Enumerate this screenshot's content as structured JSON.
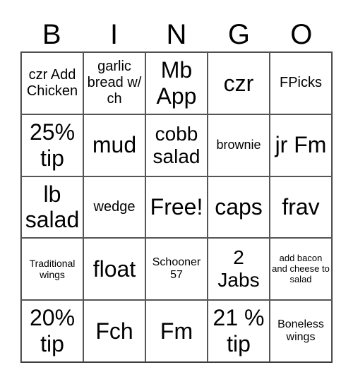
{
  "header": [
    "B",
    "I",
    "N",
    "G",
    "O"
  ],
  "cells": [
    {
      "text": "czr Add Chicken",
      "size": "s-m"
    },
    {
      "text": "garlic bread w/ ch",
      "size": "s-m"
    },
    {
      "text": "Mb App",
      "size": "s-xl"
    },
    {
      "text": "czr",
      "size": "s-xl"
    },
    {
      "text": "FPicks",
      "size": "s-m"
    },
    {
      "text": "25% tip",
      "size": "s-xl"
    },
    {
      "text": "mud",
      "size": "s-xl"
    },
    {
      "text": "cobb salad",
      "size": "s-l"
    },
    {
      "text": "brownie",
      "size": "s-sm"
    },
    {
      "text": "jr Fm",
      "size": "s-xl"
    },
    {
      "text": "lb salad",
      "size": "s-xl"
    },
    {
      "text": "wedge",
      "size": "s-m"
    },
    {
      "text": "Free!",
      "size": "s-xl"
    },
    {
      "text": "caps",
      "size": "s-xl"
    },
    {
      "text": "frav",
      "size": "s-xl"
    },
    {
      "text": "Traditional wings",
      "size": "s-xs"
    },
    {
      "text": "float",
      "size": "s-xl"
    },
    {
      "text": "Schooner 57",
      "size": "s-s"
    },
    {
      "text": "2 Jabs",
      "size": "s-l"
    },
    {
      "text": "add bacon and cheese to salad",
      "size": "s-xxs"
    },
    {
      "text": "20% tip",
      "size": "s-xl"
    },
    {
      "text": "Fch",
      "size": "s-xl"
    },
    {
      "text": "Fm",
      "size": "s-xl"
    },
    {
      "text": "21 % tip",
      "size": "s-xl"
    },
    {
      "text": "Boneless wings",
      "size": "s-s"
    }
  ]
}
